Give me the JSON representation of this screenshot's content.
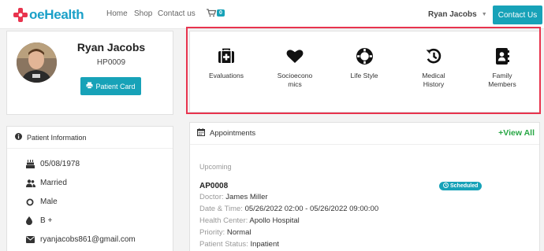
{
  "nav": {
    "brand": "oeHealth",
    "links": [
      "Home",
      "Shop",
      "Contact us"
    ],
    "cart_count": "0",
    "user": "Ryan Jacobs",
    "contact_btn": "Contact Us"
  },
  "profile": {
    "name": "Ryan Jacobs",
    "id": "HP0009",
    "card_btn": "Patient Card"
  },
  "menu": [
    {
      "label": "Evaluations",
      "icon": "medkit-icon"
    },
    {
      "label": "Socioeconomics",
      "line1": "Socioecono",
      "line2": "mics",
      "icon": "heart-icon"
    },
    {
      "label": "Life Style",
      "icon": "life-ring-icon"
    },
    {
      "label": "Medical History",
      "line1": "Medical",
      "line2": "History",
      "icon": "history-icon"
    },
    {
      "label": "Family Members",
      "line1": "Family",
      "line2": "Members",
      "icon": "address-book-icon"
    }
  ],
  "info": {
    "title": "Patient Information",
    "dob": "05/08/1978",
    "marital": "Married",
    "gender": "Male",
    "blood": "B +",
    "email": "ryanjacobs861@gmail.com"
  },
  "appointments": {
    "title": "Appointments",
    "view_all": "+View All",
    "section": "Upcoming",
    "id": "AP0008",
    "status_badge": "Scheduled",
    "doctor_label": "Doctor:",
    "doctor": "James Miller",
    "datetime_label": "Date & Time:",
    "datetime": "05/26/2022 02:00 - 05/26/2022 09:00:00",
    "center_label": "Health Center:",
    "center": "Apollo Hospital",
    "priority_label": "Priority:",
    "priority": "Normal",
    "pstatus_label": "Patient Status:",
    "pstatus": "Inpatient"
  },
  "colors": {
    "accent": "#17a2b8",
    "highlight": "#e8344e",
    "brand_red": "#e8344e",
    "view_all": "#28a745"
  }
}
